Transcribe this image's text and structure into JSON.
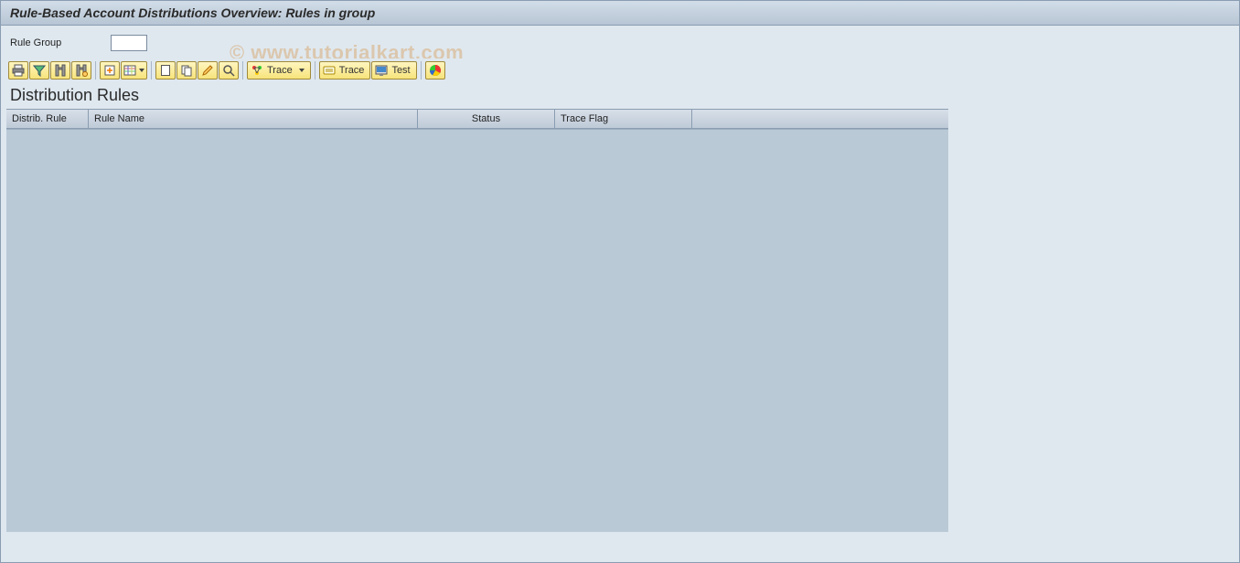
{
  "title": "Rule-Based Account Distributions Overview: Rules in group",
  "watermark": "© www.tutorialkart.com",
  "field": {
    "label": "Rule Group",
    "value": ""
  },
  "toolbar": {
    "trace1_label": "Trace",
    "trace2_label": "Trace",
    "test_label": "Test"
  },
  "section_title": "Distribution Rules",
  "columns": {
    "c1": "Distrib. Rule",
    "c2": "Rule Name",
    "c3": "Status",
    "c4": "Trace Flag"
  }
}
